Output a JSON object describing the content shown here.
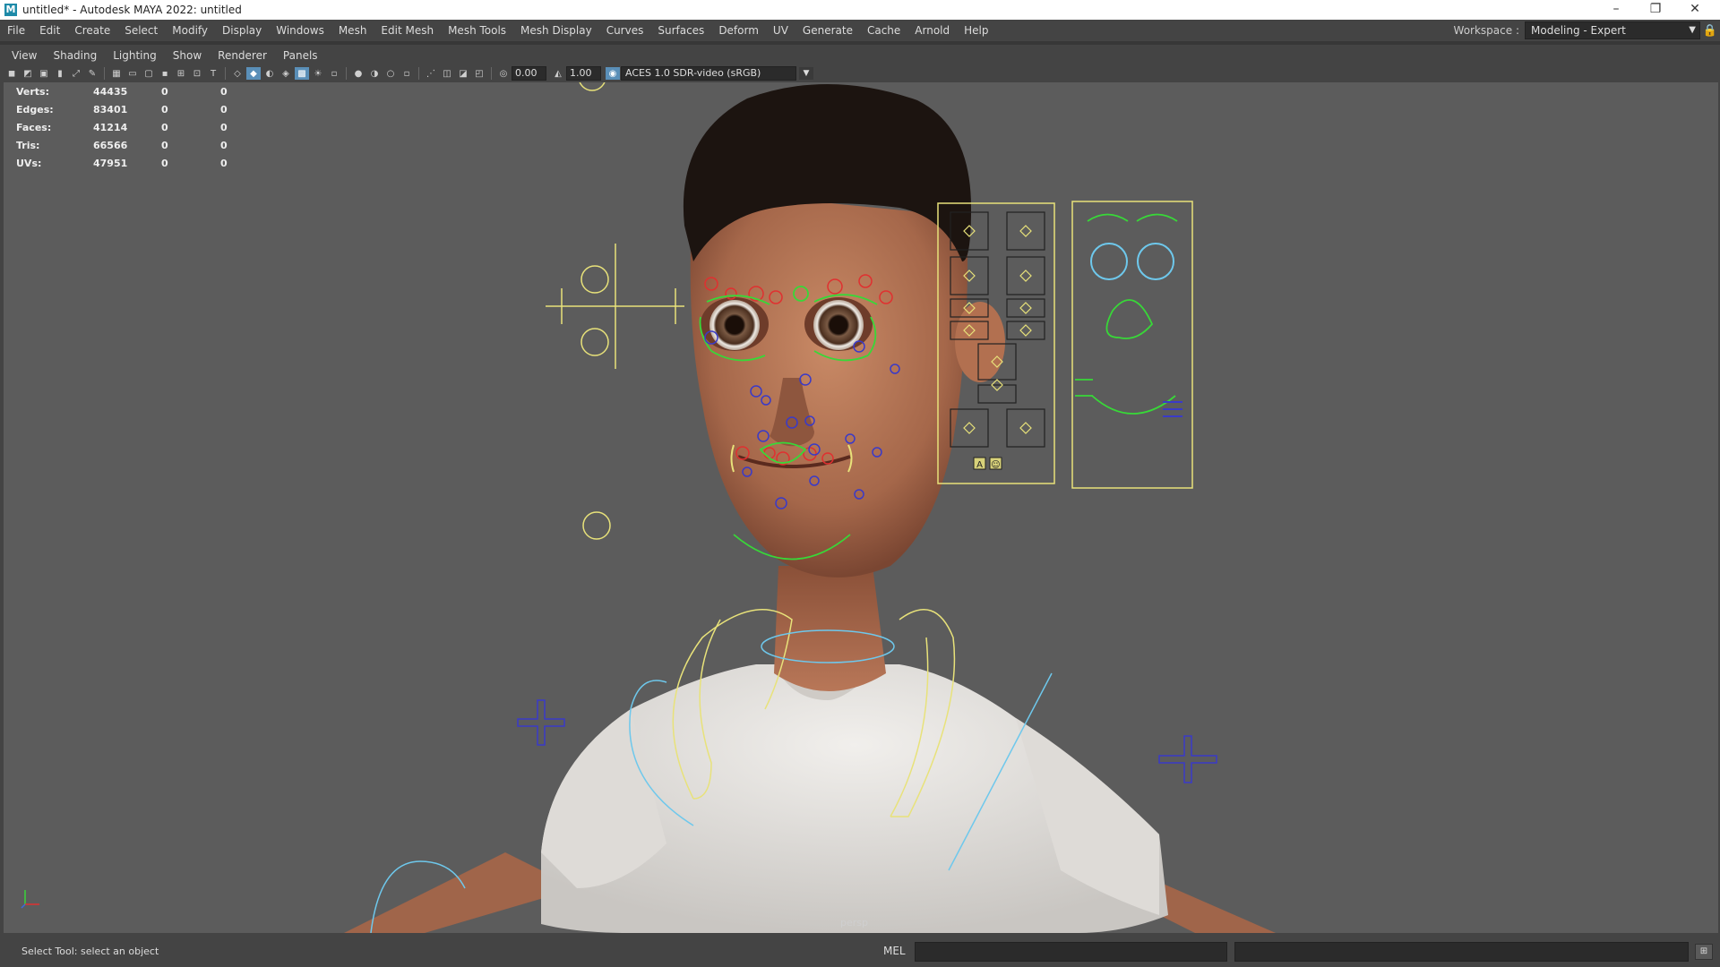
{
  "window": {
    "title": "untitled* - Autodesk MAYA 2022: untitled",
    "app_icon": "M",
    "controls": {
      "minimize": "–",
      "maximize": "❐",
      "close": "✕"
    }
  },
  "menubar": {
    "items": [
      "File",
      "Edit",
      "Create",
      "Select",
      "Modify",
      "Display",
      "Windows",
      "Mesh",
      "Edit Mesh",
      "Mesh Tools",
      "Mesh Display",
      "Curves",
      "Surfaces",
      "Deform",
      "UV",
      "Generate",
      "Cache",
      "Arnold",
      "Help"
    ],
    "workspace_label": "Workspace :",
    "workspace_value": "Modeling - Expert"
  },
  "panel_menu": {
    "items": [
      "View",
      "Shading",
      "Lighting",
      "Show",
      "Renderer",
      "Panels"
    ]
  },
  "panel_toolbar": {
    "exposure": "0.00",
    "gamma": "1.00",
    "view_transform": "ACES 1.0 SDR-video (sRGB)"
  },
  "hud": {
    "rows": [
      {
        "label": "Verts:",
        "v1": "44435",
        "v2": "0",
        "v3": "0"
      },
      {
        "label": "Edges:",
        "v1": "83401",
        "v2": "0",
        "v3": "0"
      },
      {
        "label": "Faces:",
        "v1": "41214",
        "v2": "0",
        "v3": "0"
      },
      {
        "label": "Tris:",
        "v1": "66566",
        "v2": "0",
        "v3": "0"
      },
      {
        "label": "UVs:",
        "v1": "47951",
        "v2": "0",
        "v3": "0"
      }
    ]
  },
  "viewport": {
    "camera": "persp",
    "background_color": "#5c5c5c",
    "controller_colors": {
      "yellow": "#e8e27a",
      "green": "#38d838",
      "red": "#e03030",
      "blue": "#3a3ac8",
      "cyan": "#6ec8ec"
    },
    "panel_buttons": [
      "A",
      "☺"
    ]
  },
  "statusbar": {
    "help_text": "Select Tool: select an object",
    "command_language": "MEL"
  }
}
